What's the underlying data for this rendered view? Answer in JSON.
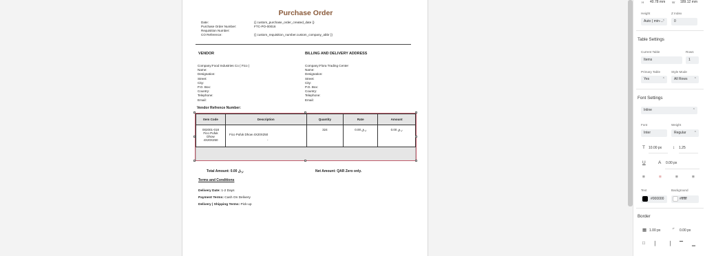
{
  "document": {
    "title": "Purchase Order",
    "meta_labels": [
      "Date:",
      "Purchase Order Number:",
      "Requisition Number:",
      "CO Reference:"
    ],
    "meta_values": [
      "{{ custom_purchase_order_created_date }}",
      "FTC-PO-00016",
      "",
      "{{ custom_requisition_number.custom_company_abbr }}"
    ],
    "vendor": {
      "heading": "VENDOR",
      "lines": [
        "Company:Food Industries Co ( Fico )",
        "Name:",
        "Designation:",
        "Street:",
        "City:",
        "P.O. Box:",
        "Country:",
        "Telephone:",
        "Email:"
      ]
    },
    "billing": {
      "heading": "BILLING AND DELIVERY ADDRESS",
      "lines": [
        "Company:Flora Trading Center",
        "Name:",
        "Designation:",
        "Street:",
        "City:",
        "P.O. Box:",
        "Country:",
        "Telephone:",
        "Email:"
      ]
    },
    "vendor_reference": "Vendor Refrence Number:",
    "table": {
      "headers": [
        "Item Code",
        "Description",
        "Quantity",
        "Rate",
        "Amount"
      ],
      "rows": [
        {
          "item_code": "002001-018 Fico Pufuk Dhow 4X20X250",
          "description": "Fico Pufuk Dhow 4X20X250",
          "description_sub": "-",
          "quantity": "324",
          "rate": "0.00 ر.ق",
          "amount": "0.00 ر.ق"
        }
      ]
    },
    "total_amount": "Total Amount: 0.00 ر.ق",
    "net_amount": "Net Amount: QAR Zero only.",
    "terms_heading": "Terms and Conditions",
    "terms": [
      {
        "label": "Delivery Date:",
        "value": " 1-2 Days"
      },
      {
        "label": "Payment Terms:",
        "value": " Cash On Delivery"
      },
      {
        "label": "Delivery | Shipping Terms:",
        "value": " Pick-up"
      }
    ]
  },
  "panel": {
    "h_label": "H",
    "h_value": "40.78 mm",
    "w_label": "W",
    "w_value": "189.12 mm",
    "height_label": "Height",
    "height_value": "Auto ( min-...",
    "zindex_label": "Z Index",
    "zindex_value": "0",
    "table_settings_title": "Table Settings",
    "current_table_label": "Current Table",
    "current_table_value": "Items",
    "rows_label": "Rows",
    "rows_value": "1",
    "primary_table_label": "Primary Table",
    "primary_table_value": "Yes",
    "style_mode_label": "Style Mode",
    "style_mode_value": "All Rows",
    "font_settings_title": "Font Settings",
    "display_value": "Inline",
    "font_label": "Font",
    "font_value": "Inter",
    "weight_label": "Weight",
    "weight_value": "Regular",
    "font_size_value": "10.00 px",
    "line_height_value": "1.25",
    "letter_spacing_value": "0.00 px",
    "text_label": "Text",
    "text_color": "#000000",
    "background_label": "Background",
    "background_color": "#ffffff",
    "border_title": "Border",
    "border_width_value": "1.00 px",
    "border_radius_value": "0.00 px"
  }
}
